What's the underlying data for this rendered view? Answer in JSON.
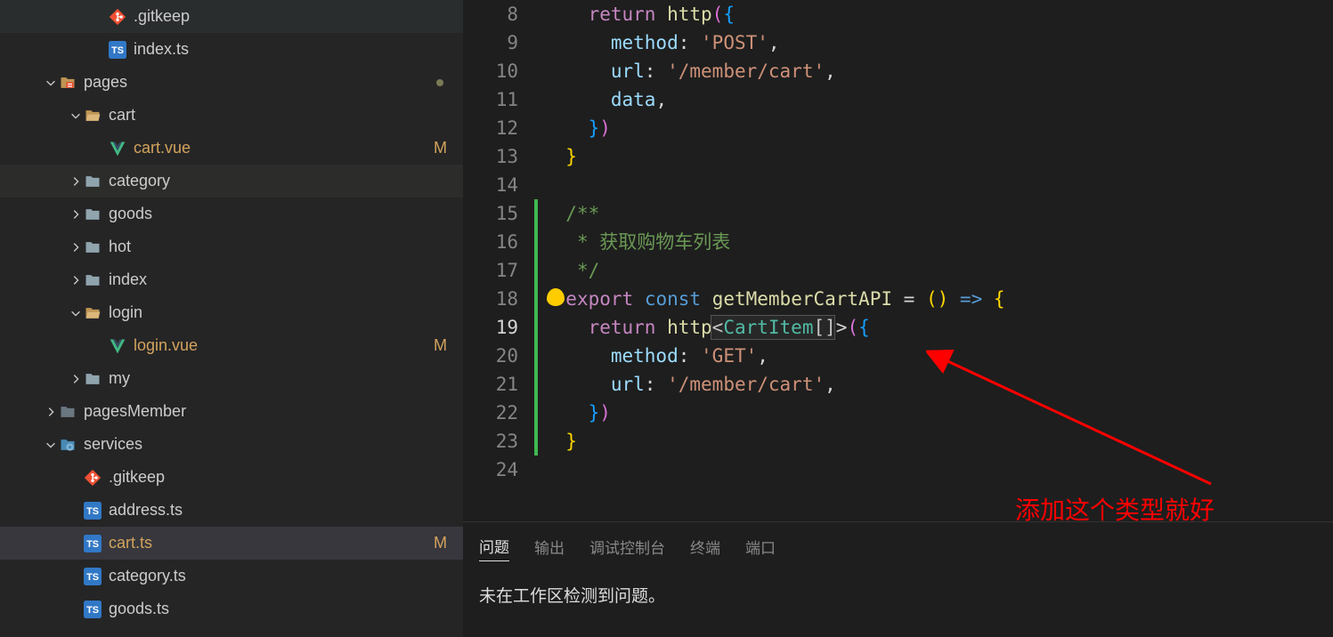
{
  "explorer": {
    "items": [
      {
        "depth": 3,
        "type": "file",
        "icon": "git",
        "label": ".gitkeep"
      },
      {
        "depth": 3,
        "type": "file",
        "icon": "ts",
        "label": "index.ts"
      },
      {
        "depth": 1,
        "type": "folder",
        "chev": "down",
        "icon": "special-folder",
        "label": "pages",
        "status": "dot"
      },
      {
        "depth": 2,
        "type": "folder",
        "chev": "down",
        "icon": "folder-open",
        "label": "cart"
      },
      {
        "depth": 3,
        "type": "file",
        "icon": "vue",
        "label": "cart.vue",
        "status": "M"
      },
      {
        "depth": 2,
        "type": "folder",
        "chev": "right",
        "icon": "folder",
        "label": "category",
        "sel": "light"
      },
      {
        "depth": 2,
        "type": "folder",
        "chev": "right",
        "icon": "folder",
        "label": "goods"
      },
      {
        "depth": 2,
        "type": "folder",
        "chev": "right",
        "icon": "folder",
        "label": "hot"
      },
      {
        "depth": 2,
        "type": "folder",
        "chev": "right",
        "icon": "folder",
        "label": "index"
      },
      {
        "depth": 2,
        "type": "folder",
        "chev": "down",
        "icon": "folder-open",
        "label": "login"
      },
      {
        "depth": 3,
        "type": "file",
        "icon": "vue",
        "label": "login.vue",
        "status": "M"
      },
      {
        "depth": 2,
        "type": "folder",
        "chev": "right",
        "icon": "folder",
        "label": "my"
      },
      {
        "depth": 1,
        "type": "folder",
        "chev": "right",
        "icon": "folder-dim",
        "label": "pagesMember"
      },
      {
        "depth": 1,
        "type": "folder",
        "chev": "down",
        "icon": "services-folder",
        "label": "services"
      },
      {
        "depth": 2,
        "type": "file",
        "icon": "git",
        "label": ".gitkeep"
      },
      {
        "depth": 2,
        "type": "file",
        "icon": "ts",
        "label": "address.ts"
      },
      {
        "depth": 2,
        "type": "file",
        "icon": "ts",
        "label": "cart.ts",
        "status": "M",
        "sel": "selected"
      },
      {
        "depth": 2,
        "type": "file",
        "icon": "ts",
        "label": "category.ts"
      },
      {
        "depth": 2,
        "type": "file",
        "icon": "ts",
        "label": "goods.ts"
      }
    ]
  },
  "editor": {
    "lines": [
      {
        "n": 8,
        "tokens": [
          [
            "    ",
            ""
          ],
          [
            "return",
            "c-kw"
          ],
          [
            " ",
            ""
          ],
          [
            "http",
            "c-fn"
          ],
          [
            "(",
            "c-brace2"
          ],
          [
            "{",
            "c-brace3"
          ]
        ]
      },
      {
        "n": 9,
        "tokens": [
          [
            "      ",
            ""
          ],
          [
            "method",
            "c-id"
          ],
          [
            ":",
            "c-plain"
          ],
          [
            " ",
            ""
          ],
          [
            "'POST'",
            "c-str"
          ],
          [
            ",",
            "c-plain"
          ]
        ]
      },
      {
        "n": 10,
        "tokens": [
          [
            "      ",
            ""
          ],
          [
            "url",
            "c-id"
          ],
          [
            ":",
            "c-plain"
          ],
          [
            " ",
            ""
          ],
          [
            "'/member/cart'",
            "c-str"
          ],
          [
            ",",
            "c-plain"
          ]
        ]
      },
      {
        "n": 11,
        "tokens": [
          [
            "      ",
            ""
          ],
          [
            "data",
            "c-id"
          ],
          [
            ",",
            "c-plain"
          ]
        ]
      },
      {
        "n": 12,
        "tokens": [
          [
            "    ",
            ""
          ],
          [
            "}",
            "c-brace3"
          ],
          [
            ")",
            "c-brace2"
          ]
        ]
      },
      {
        "n": 13,
        "tokens": [
          [
            "  ",
            ""
          ],
          [
            "}",
            "c-brace"
          ]
        ]
      },
      {
        "n": 14,
        "tokens": [
          [
            "",
            ""
          ]
        ]
      },
      {
        "n": 15,
        "tokens": [
          [
            "  ",
            ""
          ],
          [
            "/**",
            "c-comment"
          ]
        ]
      },
      {
        "n": 16,
        "tokens": [
          [
            "  ",
            ""
          ],
          [
            " * 获取购物车列表",
            "c-comment"
          ]
        ]
      },
      {
        "n": 17,
        "tokens": [
          [
            "  ",
            ""
          ],
          [
            " */",
            "c-comment"
          ]
        ]
      },
      {
        "n": 18,
        "tokens": [
          [
            "  ",
            ""
          ],
          [
            "export",
            "c-kw"
          ],
          [
            " ",
            ""
          ],
          [
            "const",
            "c-kw2"
          ],
          [
            " ",
            ""
          ],
          [
            "getMemberCartAPI",
            "c-fn"
          ],
          [
            " ",
            "c-plain"
          ],
          [
            "=",
            "c-plain"
          ],
          [
            " ",
            ""
          ],
          [
            "(",
            "c-brace"
          ],
          [
            ")",
            "c-brace"
          ],
          [
            " ",
            ""
          ],
          [
            "=>",
            "c-kw2"
          ],
          [
            " ",
            ""
          ],
          [
            "{",
            "c-brace"
          ]
        ]
      },
      {
        "n": 19,
        "tokens": [
          [
            "    ",
            ""
          ],
          [
            "return",
            "c-kw"
          ],
          [
            " ",
            ""
          ],
          [
            "http",
            "c-fn"
          ],
          [
            "<",
            "c-plain"
          ],
          [
            "CartItem",
            "c-type"
          ],
          [
            "[]",
            "c-plain"
          ],
          [
            ">",
            "c-plain"
          ],
          [
            "(",
            "c-brace2"
          ],
          [
            "{",
            "c-brace3"
          ]
        ],
        "active": true
      },
      {
        "n": 20,
        "tokens": [
          [
            "      ",
            ""
          ],
          [
            "method",
            "c-id"
          ],
          [
            ":",
            "c-plain"
          ],
          [
            " ",
            ""
          ],
          [
            "'GET'",
            "c-str"
          ],
          [
            ",",
            "c-plain"
          ]
        ]
      },
      {
        "n": 21,
        "tokens": [
          [
            "      ",
            ""
          ],
          [
            "url",
            "c-id"
          ],
          [
            ":",
            "c-plain"
          ],
          [
            " ",
            ""
          ],
          [
            "'/member/cart'",
            "c-str"
          ],
          [
            ",",
            "c-plain"
          ]
        ]
      },
      {
        "n": 22,
        "tokens": [
          [
            "    ",
            ""
          ],
          [
            "}",
            "c-brace3"
          ],
          [
            ")",
            "c-brace2"
          ]
        ]
      },
      {
        "n": 23,
        "tokens": [
          [
            "  ",
            ""
          ],
          [
            "}",
            "c-brace"
          ]
        ]
      },
      {
        "n": 24,
        "tokens": [
          [
            "",
            ""
          ]
        ]
      }
    ]
  },
  "annotation": "添加这个类型就好",
  "panel": {
    "tabs": [
      "问题",
      "输出",
      "调试控制台",
      "终端",
      "端口"
    ],
    "active": 0,
    "message": "未在工作区检测到问题。"
  }
}
